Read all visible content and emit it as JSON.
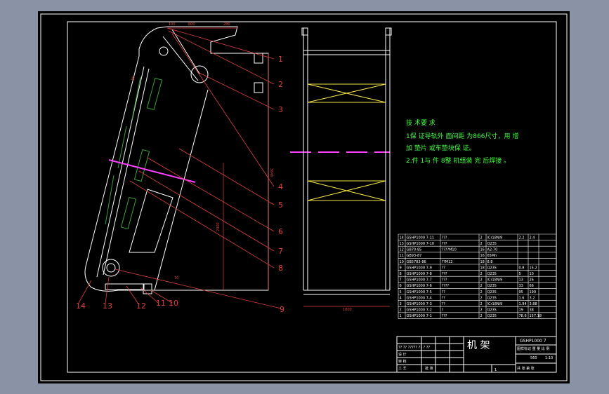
{
  "viewport": {
    "background": "#000000",
    "window_bg": "#8a93a6"
  },
  "colors": {
    "frame": "#ffffff",
    "outline": "#ffffff",
    "balloon": "#e04040",
    "dim": "#e04040",
    "slot": "#3aa03a",
    "center": "#ff40ff",
    "bracing": "#f2e44a",
    "note": "#40ff40",
    "table": "#ffffff"
  },
  "dims": {
    "top_a": "100",
    "top_b": "800",
    "top_c": "280",
    "right_height": "3640",
    "inner_height": "2000",
    "angle": "70",
    "small_a": "R",
    "left_a": "80",
    "bottom_width": "1800"
  },
  "balloons": [
    "1",
    "2",
    "3",
    "4",
    "5",
    "6",
    "7",
    "8",
    "9",
    "10",
    "11",
    "12",
    "13",
    "14"
  ],
  "notes": {
    "heading": "技 术要 求",
    "line1": "1保 证导轨外 面间距 为866尺寸，用 增",
    "line2": "加 垫片 或车垫块保 证。",
    "line3": "2.件 1与 件 8整 机组装 完 后焊接 。"
  },
  "parts": [
    [
      "14",
      "GSHP1000 7-11",
      "???",
      "2",
      "ICr18Ni9",
      "2.2",
      "2.4"
    ],
    [
      "13",
      "GSHP1000 7-10",
      "???",
      "2",
      "Q235",
      "",
      ""
    ],
    [
      "12",
      "GB70-85",
      "????M10",
      "16",
      "A2-70",
      "",
      ""
    ],
    [
      "11",
      "GB93-87",
      "",
      "16",
      "65Mn",
      "",
      ""
    ],
    [
      "10",
      "GB5783-86",
      "??M12",
      "18",
      "8.8",
      "",
      ""
    ],
    [
      "9",
      "GSHP1000 7-9",
      "??",
      "18",
      "Q235",
      "0.8",
      "15.2"
    ],
    [
      "8",
      "GSHP1000 7-8",
      "???",
      "2",
      "Q235",
      "5",
      "10"
    ],
    [
      "7",
      "GSHP1000 7-7",
      "???",
      "2",
      "ICr18Ni9",
      "13",
      "26"
    ],
    [
      "6",
      "GSHP1000 7-6",
      "????",
      "2",
      "Q235",
      "33",
      "66"
    ],
    [
      "5",
      "GSHP1000 7-5",
      "??",
      "2",
      "Q235",
      "95",
      "190"
    ],
    [
      "4",
      "GSHP1000 7-4",
      "??",
      "2",
      "Q235",
      "1.6",
      "3.2"
    ],
    [
      "3",
      "GSHP1000 7-3",
      "??",
      "2",
      "ICr18Ni9",
      "1.94",
      "3.88"
    ],
    [
      "2",
      "GSHP1000 7-2",
      "?",
      "2",
      "Q235",
      "19",
      "38"
    ],
    [
      "1",
      "GSHP1000 7-1",
      "???",
      "2",
      "Q235",
      "78.6",
      "157.18"
    ]
  ],
  "titleblock": {
    "drawing_no": "GSHP1000 7",
    "name": "机 架",
    "stage": "图样标记 重 量 比 例",
    "weight": "560",
    "scale": "1:10",
    "row_a": "?? ?? ????? ?? ? ??",
    "row_b": "设 计",
    "row_c": "审 核",
    "row_d": "工 艺",
    "row_e": "批 准",
    "sheet": "共 张 第 张",
    "sheet_no": "1"
  }
}
